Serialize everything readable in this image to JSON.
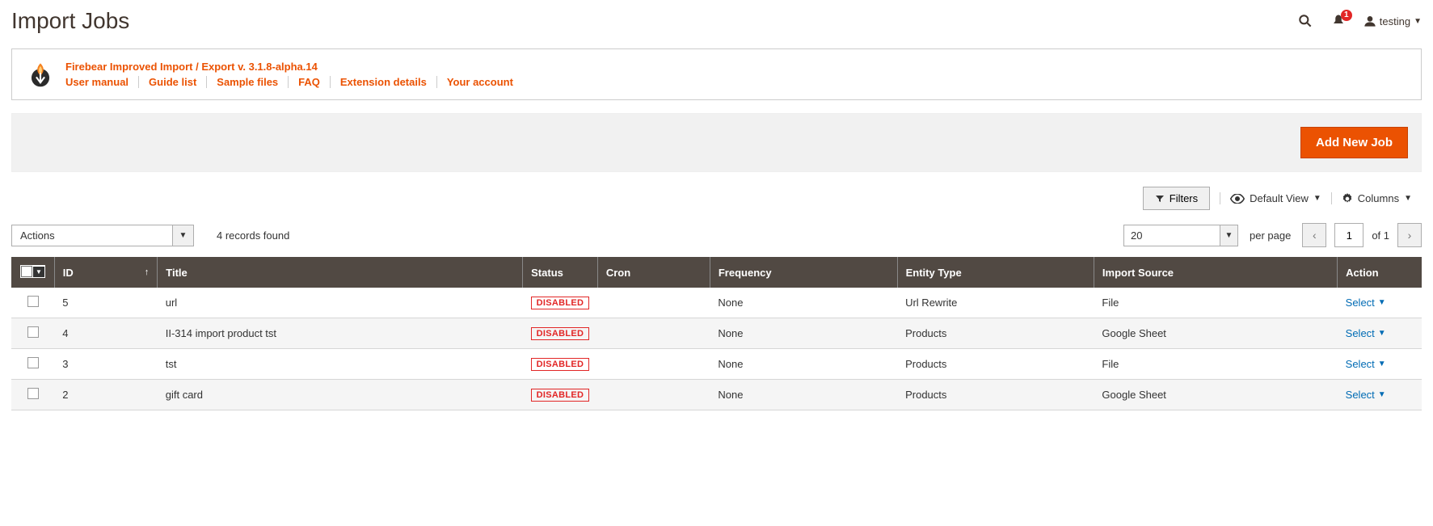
{
  "page": {
    "title": "Import Jobs"
  },
  "header": {
    "notifications": "1",
    "user": "testing"
  },
  "info": {
    "title": "Firebear Improved Import / Export v. 3.1.8-alpha.14",
    "links": [
      "User manual",
      "Guide list",
      "Sample files",
      "FAQ",
      "Extension details",
      "Your account"
    ]
  },
  "actions": {
    "add": "Add New Job",
    "filters": "Filters",
    "default_view": "Default View",
    "columns": "Columns",
    "mass_action": "Actions"
  },
  "grid_meta": {
    "records_found": "4 records found",
    "page_size": "20",
    "per_page": "per page",
    "page": "1",
    "of": "of 1"
  },
  "columns": {
    "id": "ID",
    "title": "Title",
    "status": "Status",
    "cron": "Cron",
    "frequency": "Frequency",
    "entity": "Entity Type",
    "source": "Import Source",
    "action": "Action"
  },
  "status_label": "DISABLED",
  "select_label": "Select",
  "rows": [
    {
      "id": "5",
      "title": "url",
      "cron": "",
      "frequency": "None",
      "entity": "Url Rewrite",
      "source": "File"
    },
    {
      "id": "4",
      "title": "II-314 import product tst",
      "cron": "",
      "frequency": "None",
      "entity": "Products",
      "source": "Google Sheet"
    },
    {
      "id": "3",
      "title": "tst",
      "cron": "",
      "frequency": "None",
      "entity": "Products",
      "source": "File"
    },
    {
      "id": "2",
      "title": "gift card",
      "cron": "",
      "frequency": "None",
      "entity": "Products",
      "source": "Google Sheet"
    }
  ]
}
